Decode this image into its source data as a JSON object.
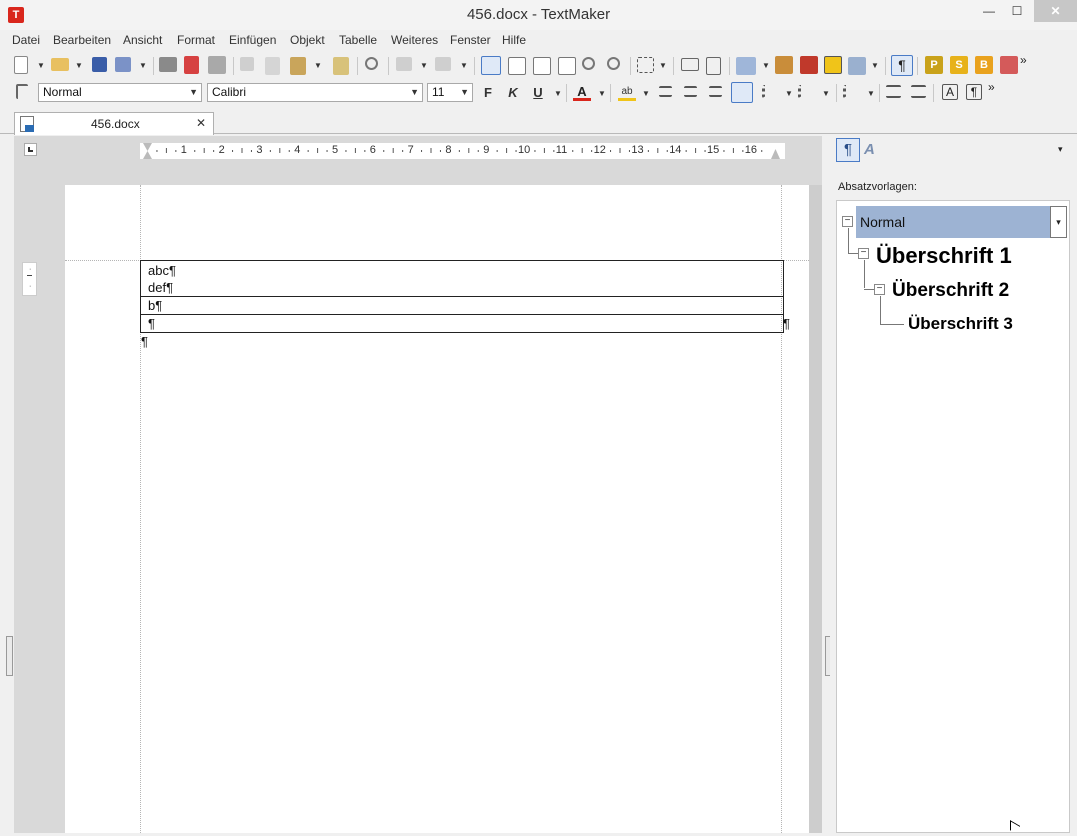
{
  "window": {
    "title": "456.docx - TextMaker",
    "app_icon_letter": "T",
    "minimize": "—",
    "maximize": "☐",
    "close": "✕"
  },
  "menu": [
    "Datei",
    "Bearbeiten",
    "Ansicht",
    "Format",
    "Einfügen",
    "Objekt",
    "Tabelle",
    "Weiteres",
    "Fenster",
    "Hilfe"
  ],
  "format_bar": {
    "style": "Normal",
    "font": "Calibri",
    "size": "11",
    "bold": "F",
    "italic": "K",
    "underline": "U",
    "font_color": "A",
    "highlight": "ab",
    "pilcrow": "¶"
  },
  "toolbar_letters": {
    "P": "P",
    "S": "S",
    "B": "B",
    "more": "»"
  },
  "tab": {
    "label": "456.docx",
    "close": "✕"
  },
  "ruler": {
    "numbers": [
      "1",
      "2",
      "3",
      "4",
      "5",
      "6",
      "7",
      "8",
      "9",
      "10",
      "11",
      "12",
      "13",
      "14",
      "15",
      "16"
    ]
  },
  "document": {
    "cells": [
      "abc¶",
      "def¶",
      "b¶",
      "¶"
    ],
    "end_row_mark": "¶",
    "after_table_mark": "¶"
  },
  "sidebar": {
    "tab_paragraph": "¶",
    "tab_char": "A",
    "dropdown": "▾",
    "heading": "Absatzvorlagen:",
    "styles": [
      "Normal",
      "Überschrift 1",
      "Überschrift 2",
      "Überschrift 3"
    ]
  },
  "colors": {
    "selected_style_bg": "#9db3d3",
    "accent_red": "#d9261c",
    "accent_yellow": "#f0c419"
  }
}
